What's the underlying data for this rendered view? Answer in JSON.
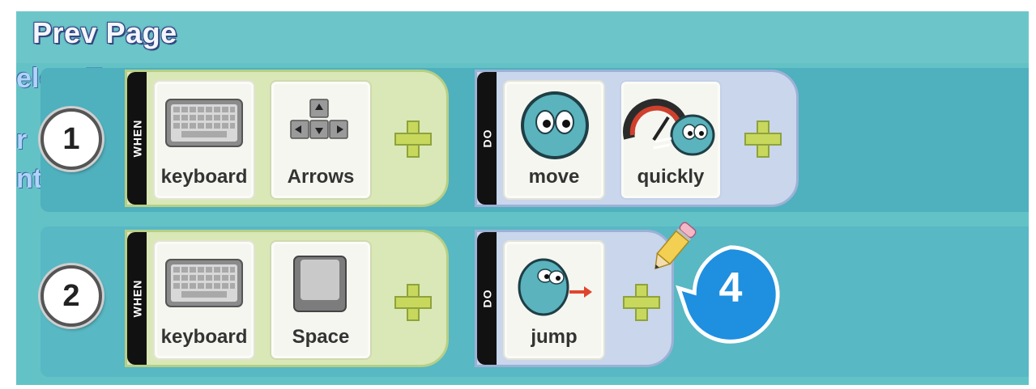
{
  "header": {
    "prev_page": "Prev Page"
  },
  "background_fragments": {
    "line1": "elete T",
    "line2": "r",
    "line3": "nt Roc"
  },
  "rules": [
    {
      "number": "1",
      "when": {
        "tab_label": "WHEN",
        "trigger_label": "keyboard",
        "key_label": "Arrows"
      },
      "do": {
        "tab_label": "DO",
        "action_label": "move",
        "modifier_label": "quickly"
      }
    },
    {
      "number": "2",
      "when": {
        "tab_label": "WHEN",
        "trigger_label": "keyboard",
        "key_label": "Space"
      },
      "do": {
        "tab_label": "DO",
        "action_label": "jump"
      }
    }
  ],
  "callout": {
    "number": "4"
  },
  "colors": {
    "background": "#63c2c6",
    "when_block": "#d9e8b6",
    "do_block": "#c9d6ec",
    "callout": "#1f8fe0"
  },
  "icons": [
    "keyboard-icon",
    "arrow-keys-icon",
    "space-key-icon",
    "move-character-icon",
    "speedometer-icon",
    "jump-character-icon",
    "plus-icon",
    "pencil-icon"
  ]
}
